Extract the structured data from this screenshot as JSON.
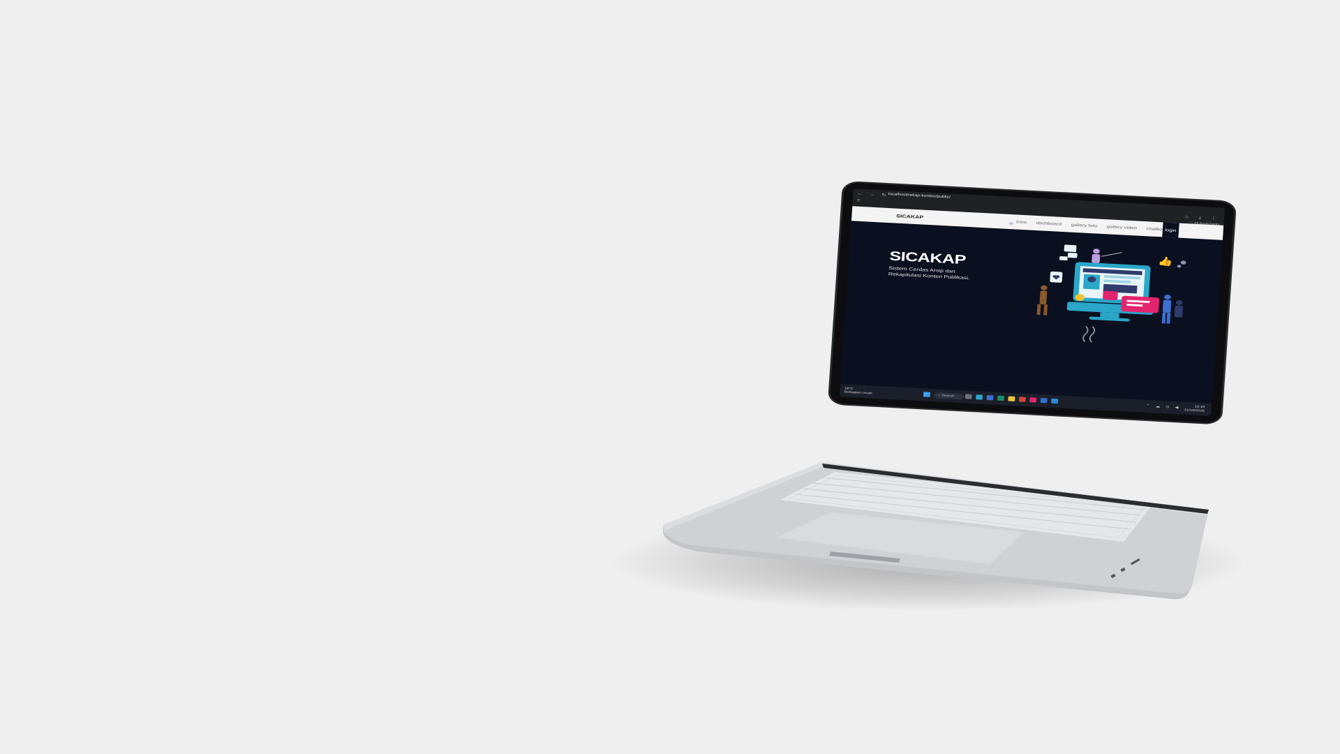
{
  "browser": {
    "url": "localhost/rekap-konten/public/",
    "bookmarks_label": "All Bookmarks",
    "nav_glyphs": "← → ↻",
    "tool_glyphs": "☆ ⤓ ⋮"
  },
  "site": {
    "brand": "SICAKAP",
    "menu": [
      "intro",
      "dashboard",
      "gallery foto",
      "gallery video",
      "chatbot"
    ],
    "login_label": "login"
  },
  "hero": {
    "title": "SICAKAP",
    "subtitle": "Sistem Cerdas Arsip dan Rekapitulasi Konten Publikasi."
  },
  "taskbar": {
    "weather_temp": "19°C",
    "weather_desc": "Sebagian cerah",
    "search_placeholder": "Search",
    "time": "10:15",
    "date": "21/10/2025"
  },
  "colors": {
    "background": "#efefef",
    "screen_bg": "#0b1020",
    "accent_blue": "#2aa7c9",
    "accent_pink": "#e2246e"
  }
}
